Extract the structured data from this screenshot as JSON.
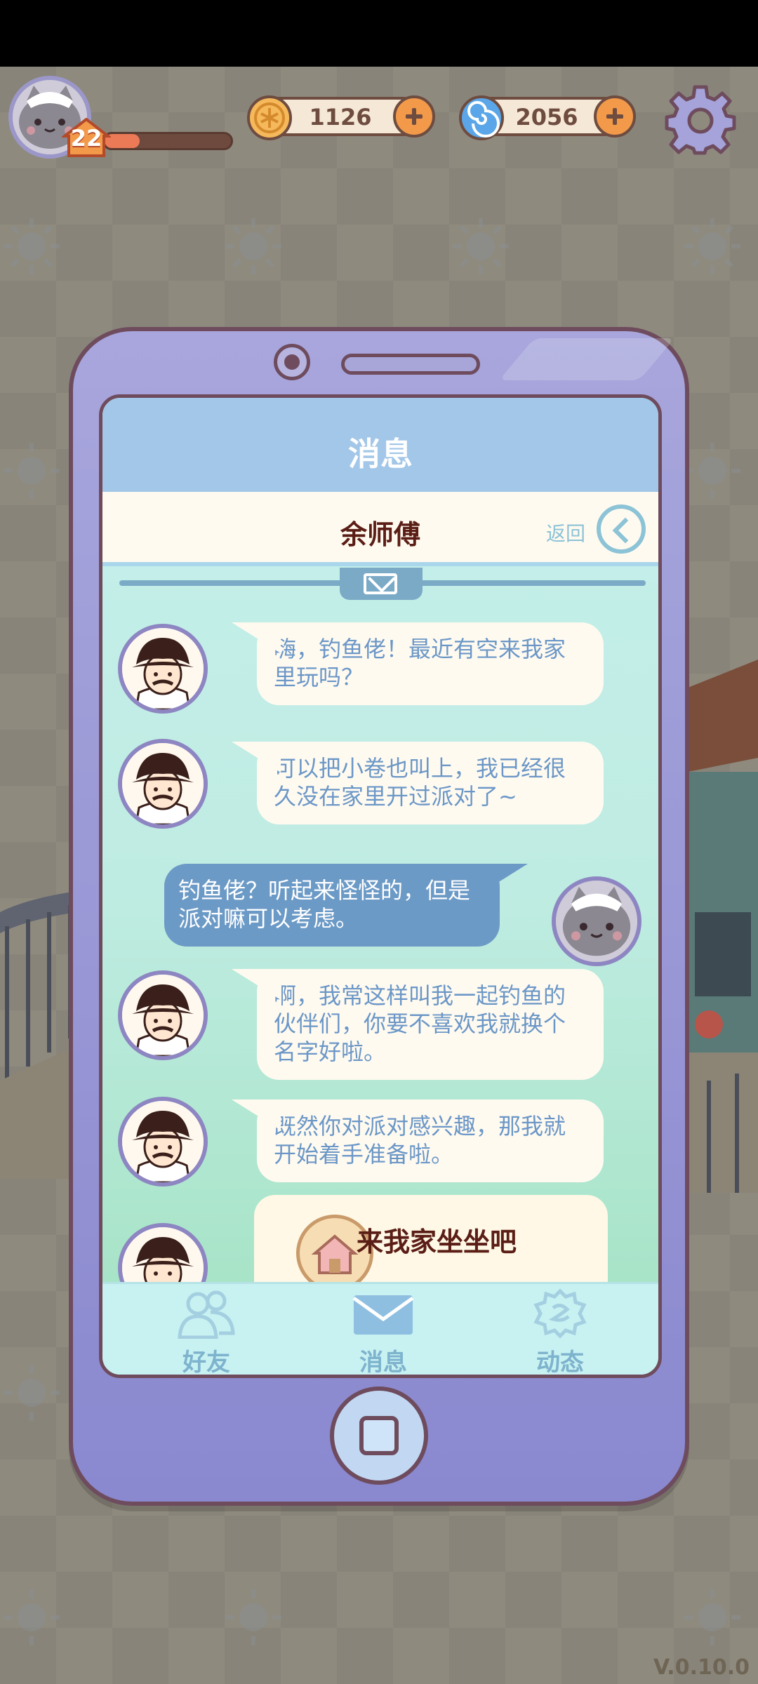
{
  "hud": {
    "player_level": "22",
    "xp_progress": 0.28,
    "currency_coins": "1126",
    "currency_gems": "2056"
  },
  "phone": {
    "title": "消息",
    "contact_name": "余师傅",
    "back_label": "返回",
    "messages": [
      {
        "sender": "npc",
        "text": "嗨，钓鱼佬！最近有空来我家里玩吗？"
      },
      {
        "sender": "npc",
        "text": "可以把小卷也叫上，我已经很久没在家里开过派对了~"
      },
      {
        "sender": "player",
        "text": "钓鱼佬？听起来怪怪的，但是派对嘛可以考虑。"
      },
      {
        "sender": "npc",
        "text": "啊，我常这样叫我一起钓鱼的伙伴们，你要不喜欢我就换个名字好啦。"
      },
      {
        "sender": "npc",
        "text": "既然你对派对感兴趣，那我就开始着手准备啦。"
      }
    ],
    "invite_card_title": "来我家坐坐吧",
    "tabs": [
      {
        "label": "好友",
        "icon": "friends-icon"
      },
      {
        "label": "消息",
        "icon": "mail-icon",
        "active": true
      },
      {
        "label": "动态",
        "icon": "moments-icon"
      }
    ]
  },
  "version": "V.0.10.0",
  "colors": {
    "phone_body": "#9795d4",
    "screen_bg": "#c3eee9",
    "npc_bubble": "#fffaf0",
    "npc_text": "#6b97c7",
    "player_bubble": "#6c9ac6",
    "outline": "#6e4c5e"
  }
}
